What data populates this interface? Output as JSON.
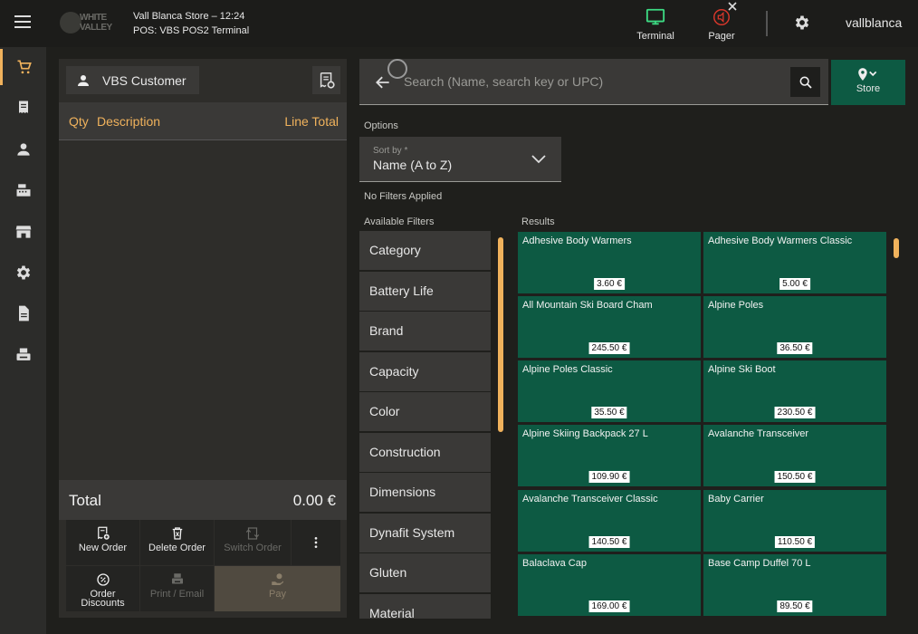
{
  "header": {
    "store_line": "Vall Blanca Store – 12:24",
    "pos_line": "POS: VBS POS2 Terminal",
    "logo_text": "WHITE VALLEY",
    "terminal_label": "Terminal",
    "pager_label": "Pager",
    "user_name": "vallblanca"
  },
  "order": {
    "customer_label": "VBS Customer",
    "col_qty": "Qty",
    "col_desc": "Description",
    "col_total": "Line Total",
    "total_label": "Total",
    "total_value": "0.00 €",
    "actions": {
      "new_order": "New Order",
      "delete_order": "Delete Order",
      "switch_order": "Switch Order",
      "order_discounts_1": "Order",
      "order_discounts_2": "Discounts",
      "print_email": "Print / Email",
      "pay": "Pay"
    }
  },
  "search": {
    "placeholder": "Search (Name, search key or UPC)",
    "store_label": "Store"
  },
  "options": {
    "options_label": "Options",
    "sort_label": "Sort by *",
    "sort_value": "Name (A to Z)",
    "no_filters": "No Filters Applied",
    "available_filters": "Available Filters",
    "results_label": "Results"
  },
  "filters": [
    "Category",
    "Battery Life",
    "Brand",
    "Capacity",
    "Color",
    "Construction",
    "Dimensions",
    "Dynafit System",
    "Gluten",
    "Material"
  ],
  "products": [
    {
      "name": "Adhesive Body Warmers",
      "price": "3.60 €"
    },
    {
      "name": "Adhesive Body Warmers Classic",
      "price": "5.00 €"
    },
    {
      "name": "All Mountain Ski Board Cham",
      "price": "245.50 €"
    },
    {
      "name": "Alpine Poles",
      "price": "36.50 €"
    },
    {
      "name": "Alpine Poles Classic",
      "price": "35.50 €"
    },
    {
      "name": "Alpine Ski Boot",
      "price": "230.50 €"
    },
    {
      "name": "Alpine Skiing Backpack 27 L",
      "price": "109.90 €"
    },
    {
      "name": "Avalanche Transceiver",
      "price": "150.50 €"
    },
    {
      "name": "Avalanche Transceiver Classic",
      "price": "140.50 €"
    },
    {
      "name": "Baby Carrier",
      "price": "110.50 €"
    },
    {
      "name": "Balaclava Cap",
      "price": "169.00 €"
    },
    {
      "name": "Base Camp Duffel 70 L",
      "price": "89.50 €"
    }
  ],
  "colors": {
    "accent": "#f0b25c",
    "product_card": "#0d5a43",
    "terminal_icon": "#3ddc84",
    "pager_icon": "#d9372b"
  }
}
